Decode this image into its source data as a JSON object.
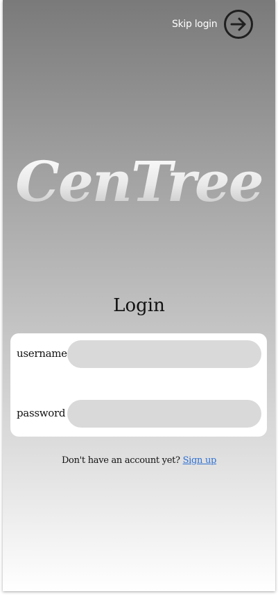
{
  "header": {
    "skip_label": "Skip login",
    "skip_icon": "arrow-right-circle-icon"
  },
  "brand": {
    "logo_text": "CenTree"
  },
  "login": {
    "title": "Login",
    "fields": [
      {
        "label": "username",
        "value": "",
        "placeholder": ""
      },
      {
        "label": "password",
        "value": "",
        "placeholder": ""
      }
    ]
  },
  "footer": {
    "prompt": "Don't have an account yet?",
    "link_label": "Sign up"
  },
  "colors": {
    "link": "#2d6fd1",
    "input_bg": "#d9d9d9",
    "card_bg": "#ffffff",
    "gradient_top": "#7a7a7a",
    "gradient_bottom": "#ffffff"
  }
}
